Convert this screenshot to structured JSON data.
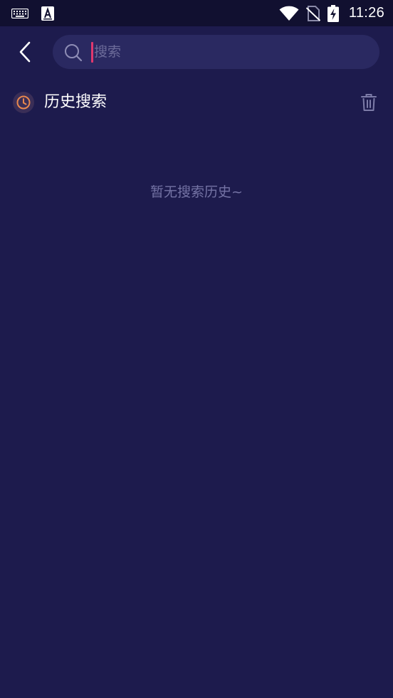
{
  "status_bar": {
    "time": "11:26",
    "icons": [
      "keyboard-icon",
      "text-a-icon",
      "wifi-icon",
      "no-sim-icon",
      "battery-charging-icon"
    ]
  },
  "search": {
    "placeholder": "搜索",
    "value": ""
  },
  "history": {
    "title": "历史搜索",
    "empty_text": "暂无搜索历史~"
  },
  "colors": {
    "background": "#1d1b4d",
    "status_bar": "#111030",
    "search_box": "#2a2961",
    "caret": "#e0386e",
    "clock_accent": "#e9884e"
  }
}
